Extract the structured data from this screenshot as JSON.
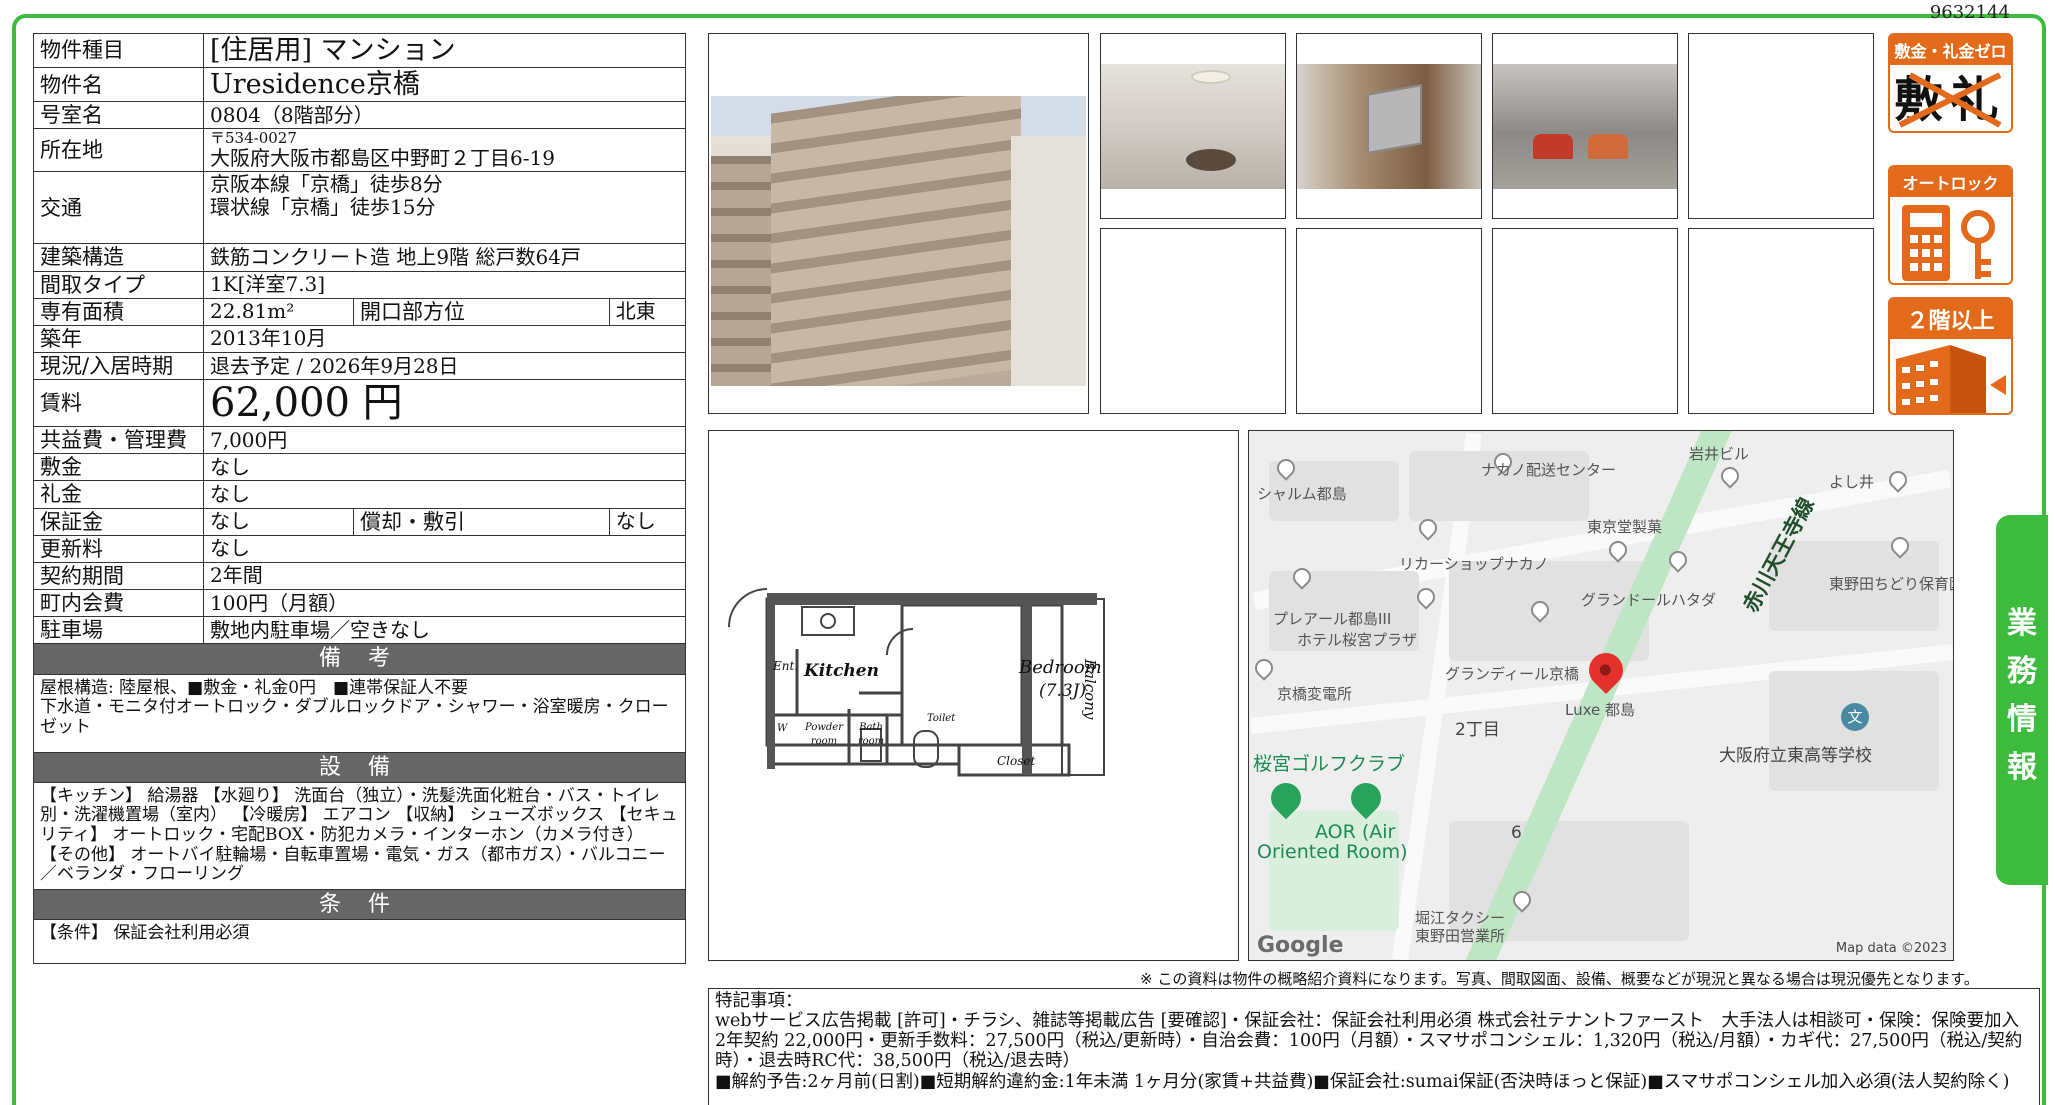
{
  "ref_no": "9632144",
  "spec": {
    "type_label": "物件種目",
    "type_value": "[住居用] マンション",
    "name_label": "物件名",
    "name_value": "Uresidence京橋",
    "room_label": "号室名",
    "room_value": "0804（8階部分）",
    "address_label": "所在地",
    "zip": "〒534-0027",
    "address": "大阪府大阪市都島区中野町２丁目6-19",
    "access_label": "交通",
    "access_1": "京阪本線「京橋」徒歩8分",
    "access_2": "環状線「京橋」徒歩15分",
    "structure_label": "建築構造",
    "structure_value": "鉄筋コンクリート造 地上9階 総戸数64戸",
    "layout_label": "間取タイプ",
    "layout_value": "1K[洋室7.3]",
    "area_label": "専有面積",
    "area_value": "22.81m²",
    "orient_label": "開口部方位",
    "orient_value": "北東",
    "built_label": "築年",
    "built_value": "2013年10月",
    "status_label": "現況/入居時期",
    "status_value": "退去予定 /  2026年9月28日",
    "rent_label": "賃料",
    "rent_value": "62,000 円",
    "fee_label": "共益費・管理費",
    "fee_value": "7,000円",
    "deposit_label": "敷金",
    "deposit_value": "なし",
    "key_label": "礼金",
    "key_value": "なし",
    "guarantee_label": "保証金",
    "guarantee_value": "なし",
    "amort_label": "償却・敷引",
    "amort_value": "なし",
    "renew_label": "更新料",
    "renew_value": "なし",
    "term_label": "契約期間",
    "term_value": "2年間",
    "assoc_label": "町内会費",
    "assoc_value": "100円（月額）",
    "parking_label": "駐車場",
    "parking_value": "敷地内駐車場／空きなし"
  },
  "bikou": {
    "title": "備 考",
    "line1": "屋根構造: 陸屋根、■敷金・礼金0円　■連帯保証人不要",
    "line2": "下水道・モニタ付オートロック・ダブルロックドア・シャワー・浴室暖房・クローゼット"
  },
  "setsubi": {
    "title": "設 備",
    "text": "【キッチン】 給湯器 【水廻り】 洗面台（独立）・洗髪洗面化粧台・バス・トイレ別・洗濯機置場（室内） 【冷暖房】 エアコン 【収納】 シューズボックス 【セキュリティ】 オートロック・宅配BOX・防犯カメラ・インターホン（カメラ付き） 【その他】 オートバイ駐輪場・自転車置場・電気・ガス（都市ガス）・バルコニー／ベランダ・フローリング"
  },
  "jouken": {
    "title": "条 件",
    "text": "【条件】 保証会社利用必須"
  },
  "badges": {
    "zero": "敷金・礼金ゼロ",
    "zero_sub1": "敷",
    "zero_sub2": "礼",
    "autolock": "オートロック",
    "floor2": "２階以上"
  },
  "floorplan": {
    "kitchen": "Kitchen",
    "bedroom": "Bedroom",
    "bedroom_size": "(7.3J)",
    "balcony": "Balcony",
    "closet": "Closet",
    "ent": "Ent.",
    "powder": "Powder room",
    "bath": "Bath room",
    "toilet": "Toilet",
    "w": "W"
  },
  "map": {
    "labels": [
      "岩井ビル",
      "ナカノ配送センター",
      "シャルム都島",
      "よし井",
      "東京堂製菓",
      "リカーショップナカノ",
      "東野田ちどり保育園",
      "グランドールハタダ",
      "プレアール都島III",
      "ホテル桜宮プラザ",
      "グランディール京橋",
      "京橋変電所",
      "Luxe 都島",
      "2丁目",
      "大阪府立東高等学校",
      "6",
      "堀江タクシー",
      "東野田営業所"
    ],
    "green_1": "桜宮ゴルフクラブ",
    "green_2": "AOR (Air",
    "green_3": "Oriented Room)",
    "rail": "赤川天王寺線",
    "google": "Google",
    "mapdata": "Map data ©2023"
  },
  "disclaimer": "※ この資料は物件の概略紹介資料になります。写真、間取図面、設備、概要などが現況と異なる場合は現況優先となります。",
  "remarks": {
    "title": "特記事項：",
    "line1": "webサービス広告掲載 [許可]・チラシ、雑誌等掲載広告 [要確認]・保証会社：保証会社利用必須 株式会社テナントファースト　大手法人は相談可・保険：保険要加入 2年契約 22,000円・更新手数料：27,500円（税込/更新時）・自治会費：100円（月額）・スマサポコンシェル：1,320円（税込/月額）・カギ代：27,500円（税込/契約時）・退去時RC代：38,500円（税込/退去時）",
    "line2": "■解約予告:2ヶ月前(日割)■短期解約違約金:1年未満 1ヶ月分(家賃+共益費)■保証会社:sumai保証(否決時ほっと保証)■スマサポコンシェル加入必須(法人契約除く)"
  },
  "side_tab": "業務情報"
}
